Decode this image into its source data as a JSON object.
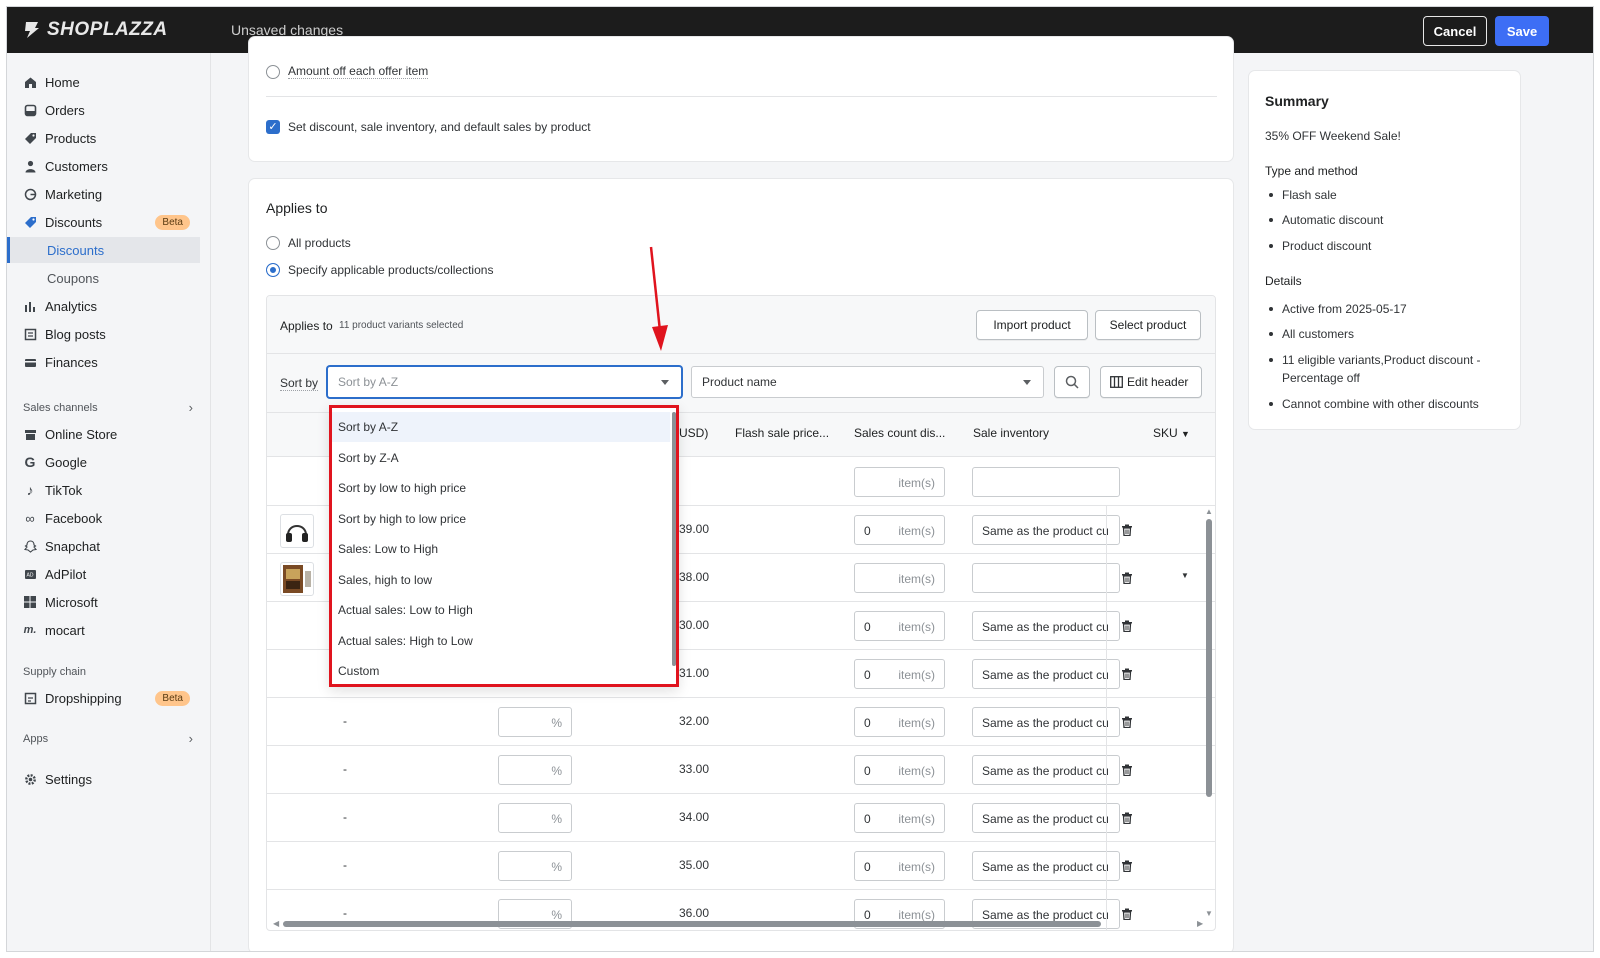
{
  "topbar": {
    "logo_text": "SHOPLAZZA",
    "status": "Unsaved changes",
    "cancel_label": "Cancel",
    "save_label": "Save"
  },
  "sidebar": {
    "items": [
      {
        "label": "Home",
        "icon": "home-icon"
      },
      {
        "label": "Orders",
        "icon": "orders-icon"
      },
      {
        "label": "Products",
        "icon": "tag-icon"
      },
      {
        "label": "Customers",
        "icon": "person-icon"
      },
      {
        "label": "Marketing",
        "icon": "marketing-icon"
      },
      {
        "label": "Discounts",
        "icon": "discount-icon",
        "badge": "Beta"
      },
      {
        "label": "Discounts",
        "sub": true,
        "active": true
      },
      {
        "label": "Coupons",
        "sub": true
      },
      {
        "label": "Analytics",
        "icon": "bar-chart-icon"
      },
      {
        "label": "Blog posts",
        "icon": "blog-icon"
      },
      {
        "label": "Finances",
        "icon": "finance-icon"
      }
    ],
    "sales_channels_label": "Sales channels",
    "channels": [
      {
        "label": "Online Store",
        "icon": "store-icon"
      },
      {
        "label": "Google",
        "icon": "google-icon"
      },
      {
        "label": "TikTok",
        "icon": "tiktok-icon"
      },
      {
        "label": "Facebook",
        "icon": "meta-icon"
      },
      {
        "label": "Snapchat",
        "icon": "snapchat-icon"
      },
      {
        "label": "AdPilot",
        "icon": "adpilot-icon"
      },
      {
        "label": "Microsoft",
        "icon": "microsoft-icon"
      },
      {
        "label": "mocart",
        "icon": "mocart-icon"
      }
    ],
    "supply_chain_label": "Supply chain",
    "dropshipping_label": "Dropshipping",
    "dropshipping_badge": "Beta",
    "apps_label": "Apps",
    "settings_label": "Settings"
  },
  "offer_card": {
    "amount_off_label": "Amount off each offer item",
    "set_discount_label": "Set discount, sale inventory, and default sales by product"
  },
  "applies_card": {
    "title": "Applies to",
    "all_products_label": "All products",
    "specify_label": "Specify applicable products/collections",
    "subheader_title": "Applies to",
    "selected_count": "11 product variants selected",
    "import_label": "Import product",
    "select_label": "Select product",
    "sort_by_label": "Sort by",
    "sort_value": "Sort by A-Z",
    "filter_value": "Product name",
    "edit_header_label": "Edit header",
    "headers": {
      "price_usd": "USD)",
      "flash_price": "Flash sale price...",
      "sales_count": "Sales count dis...",
      "sale_inventory": "Sale inventory",
      "sku": "SKU"
    },
    "item_unit": "item(s)",
    "percent_unit": "%",
    "inventory_text": "Same as the product cu",
    "rows": [
      {
        "price": "",
        "count": "",
        "inventory": ""
      },
      {
        "price": "39.00",
        "count": "0",
        "inventory": "Same as the product cu"
      },
      {
        "price": "38.00",
        "count": "",
        "inventory": ""
      },
      {
        "price": "30.00",
        "count": "0",
        "inventory": "Same as the product cu"
      },
      {
        "price": "31.00",
        "count": "0",
        "inventory": "Same as the product cu"
      },
      {
        "price": "32.00",
        "count": "0",
        "inventory": "Same as the product cu",
        "dash": "-"
      },
      {
        "price": "33.00",
        "count": "0",
        "inventory": "Same as the product cu",
        "dash": "-"
      },
      {
        "price": "34.00",
        "count": "0",
        "inventory": "Same as the product cu",
        "dash": "-"
      },
      {
        "price": "35.00",
        "count": "0",
        "inventory": "Same as the product cu",
        "dash": "-"
      },
      {
        "price": "36.00",
        "count": "0",
        "inventory": "Same as the product cu",
        "dash": "-"
      }
    ]
  },
  "sort_dropdown": {
    "options": [
      "Sort by A-Z",
      "Sort by Z-A",
      "Sort by low to high price",
      "Sort by high to low price",
      "Sales: Low to High",
      "Sales, high to low",
      "Actual sales: Low to High",
      "Actual sales: High to Low",
      "Custom"
    ],
    "selected_index": 0
  },
  "summary": {
    "title": "Summary",
    "name": "35% OFF Weekend Sale!",
    "type_title": "Type and method",
    "type_items": [
      "Flash sale",
      "Automatic discount",
      "Product discount"
    ],
    "details_title": "Details",
    "details_items": [
      "Active from 2025-05-17",
      "All customers",
      "11 eligible variants,Product discount - Percentage off",
      "Cannot combine with other discounts"
    ]
  },
  "colors": {
    "accent": "#2c6ecb",
    "save_button": "#3d6ef5",
    "highlight_box": "#e0141e",
    "topbar": "#1c1c1c",
    "beta_badge": "#ffc58b"
  }
}
